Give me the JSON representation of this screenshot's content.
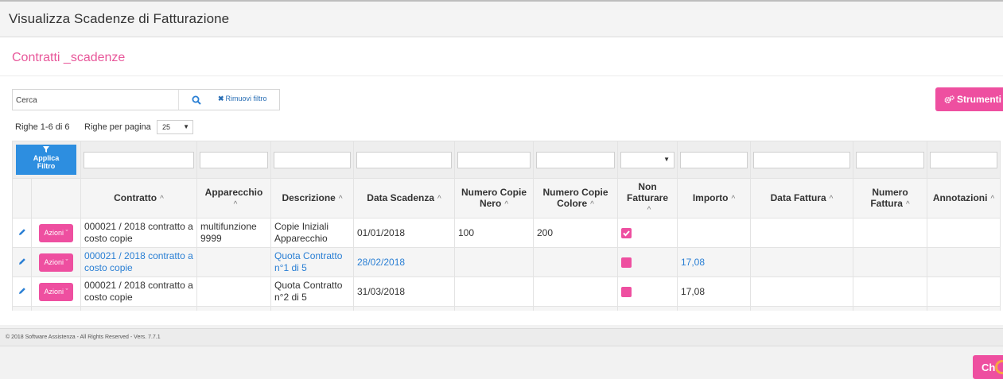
{
  "window": {
    "title": "Visualizza Scadenze di Fatturazione"
  },
  "section": {
    "title": "Contratti _scadenze"
  },
  "search": {
    "placeholder": "Cerca",
    "remove_filter_label": "Rimuovi filtro"
  },
  "tools": {
    "label": "Strumenti"
  },
  "pagination": {
    "rows_info": "Righe 1-6 di 6",
    "rows_per_page_label": "Righe per pagina",
    "rows_per_page_value": "25"
  },
  "filters": {
    "apply_line1": "Applica",
    "apply_line2": "Filtro"
  },
  "columns": {
    "contratto": "Contratto",
    "apparecchio": "Apparecchio",
    "descrizione": "Descrizione",
    "data_scadenza": "Data Scadenza",
    "copie_nero_1": "Numero Copie",
    "copie_nero_2": "Nero",
    "copie_colore_1": "Numero Copie",
    "copie_colore_2": "Colore",
    "non_fatturare_1": "Non",
    "non_fatturare_2": "Fatturare",
    "importo": "Importo",
    "data_fattura": "Data Fattura",
    "numero_fattura_1": "Numero",
    "numero_fattura_2": "Fattura",
    "annotazioni": "Annotazioni"
  },
  "rows": [
    {
      "action": "Azioni",
      "contratto_1": "000021 / 2018 contratto a",
      "contratto_2": "costo copie",
      "apparecchio_1": "multifunzione",
      "apparecchio_2": "9999",
      "descrizione_1": "Copie Iniziali",
      "descrizione_2": "Apparecchio",
      "data_scadenza": "01/01/2018",
      "copie_nero": "100",
      "copie_colore": "200",
      "non_fatturare": true,
      "importo": "",
      "data_fattura": "",
      "numero_fattura": "",
      "annotazioni": ""
    },
    {
      "action": "Azioni",
      "contratto_1": "000021 / 2018 contratto a",
      "contratto_2": "costo copie",
      "apparecchio_1": "",
      "apparecchio_2": "",
      "descrizione_1": "Quota Contratto",
      "descrizione_2": "n°1 di 5",
      "data_scadenza": "28/02/2018",
      "copie_nero": "",
      "copie_colore": "",
      "non_fatturare": false,
      "importo": "17,08",
      "data_fattura": "",
      "numero_fattura": "",
      "annotazioni": ""
    },
    {
      "action": "Azioni",
      "contratto_1": "000021 / 2018 contratto a",
      "contratto_2": "costo copie",
      "apparecchio_1": "",
      "apparecchio_2": "",
      "descrizione_1": "Quota Contratto",
      "descrizione_2": "n°2 di 5",
      "data_scadenza": "31/03/2018",
      "copie_nero": "",
      "copie_colore": "",
      "non_fatturare": false,
      "importo": "17,08",
      "data_fattura": "",
      "numero_fattura": "",
      "annotazioni": ""
    }
  ],
  "footer": {
    "copyright": "© 2018 Software Assistenza - All Rights Reserved - Vers. 7.7.1"
  },
  "close": {
    "label": "Chi"
  },
  "colors": {
    "accent": "#ee4fa0",
    "title_pink": "#e8579a",
    "link_blue": "#2a7fd4",
    "apply_blue": "#2d8ee0"
  }
}
